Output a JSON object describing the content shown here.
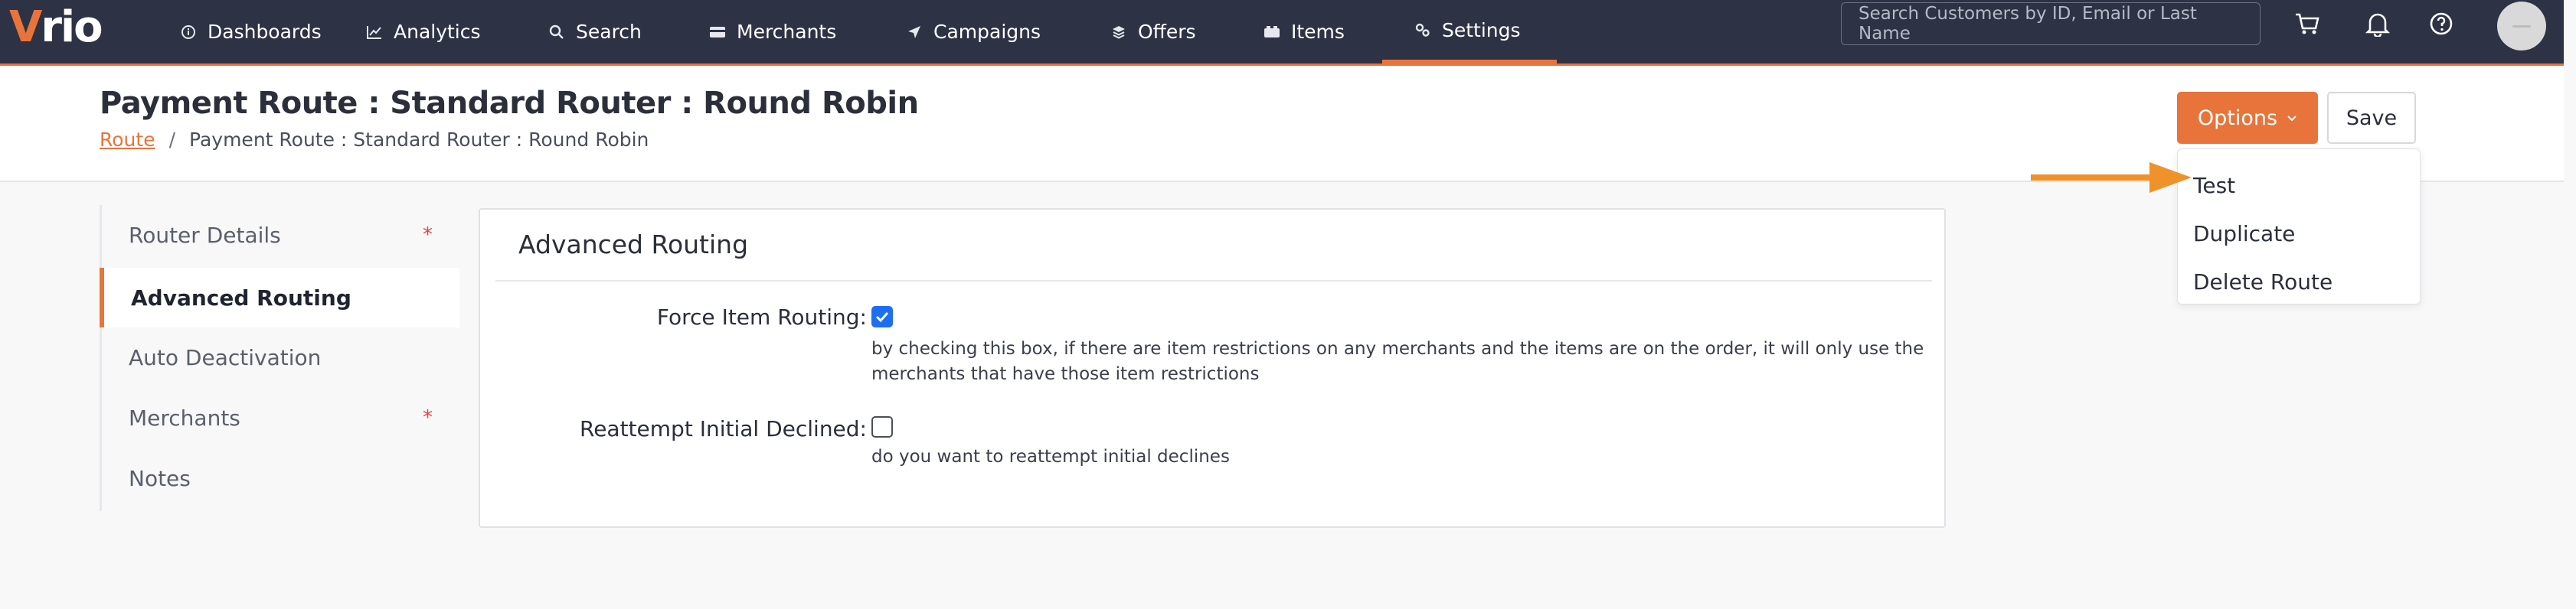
{
  "brand": {
    "logo_text": "rio",
    "logo_accent": "V",
    "accent_color": "#e8743b",
    "nav_bg": "#2d3345"
  },
  "nav": {
    "items": [
      {
        "label": "Dashboards",
        "icon": "info-circle-icon"
      },
      {
        "label": "Analytics",
        "icon": "line-chart-icon"
      },
      {
        "label": "Search",
        "icon": "search-icon"
      },
      {
        "label": "Merchants",
        "icon": "card-icon"
      },
      {
        "label": "Campaigns",
        "icon": "send-icon"
      },
      {
        "label": "Offers",
        "icon": "layers-icon"
      },
      {
        "label": "Items",
        "icon": "box-icon"
      },
      {
        "label": "Settings",
        "icon": "settings-icon",
        "active": true
      }
    ],
    "search_placeholder": "Search Customers by ID, Email or Last Name"
  },
  "header": {
    "title": "Payment Route : Standard Router : Round Robin",
    "breadcrumb": {
      "link": "Route",
      "separator": "/",
      "current": "Payment Route : Standard Router : Round Robin"
    },
    "options_label": "Options",
    "save_label": "Save"
  },
  "options_menu": {
    "items": [
      "Test",
      "Duplicate",
      "Delete Route"
    ]
  },
  "side_menu": {
    "items": [
      {
        "label": "Router Details",
        "required": true
      },
      {
        "label": "Advanced Routing",
        "active": true
      },
      {
        "label": "Auto Deactivation"
      },
      {
        "label": "Merchants",
        "required": true
      },
      {
        "label": "Notes"
      }
    ],
    "required_mark": "*"
  },
  "card": {
    "title": "Advanced Routing",
    "fields": [
      {
        "label": "Force Item Routing:",
        "checked": true,
        "help_line1": "by checking this box, if there are item restrictions on any merchants and the items are on the order, it will only use the",
        "help_line2": "merchants that have those item restrictions"
      },
      {
        "label": "Reattempt Initial Declined:",
        "checked": false,
        "help_line1": "do you want to reattempt initial declines"
      }
    ]
  }
}
